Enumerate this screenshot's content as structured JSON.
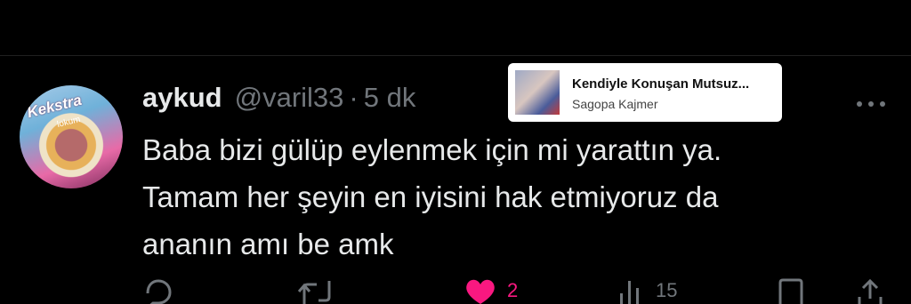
{
  "tweet": {
    "display_name": "aykud",
    "handle": "@varil33",
    "separator": "·",
    "time": "5 dk",
    "lines": [
      "Baba bizi gülüp eylenmek için mi yarattın ya.",
      "Tamam her şeyin en iyisini hak etmiyoruz da",
      "ananın amı be amk"
    ]
  },
  "avatar": {
    "brand": "Kekstra",
    "sub": "lokum"
  },
  "music": {
    "title": "Kendiyle Konuşan Mutsuz...",
    "artist": "Sagopa Kajmer"
  },
  "actions": {
    "likes": "2",
    "views": "15"
  },
  "colors": {
    "like": "#f91880",
    "muted": "#71767b",
    "text": "#e7e9ea",
    "background": "#000000"
  },
  "icons": [
    "reply-icon",
    "retweet-icon",
    "heart-icon",
    "views-icon",
    "bookmark-icon",
    "share-icon",
    "more-icon"
  ]
}
